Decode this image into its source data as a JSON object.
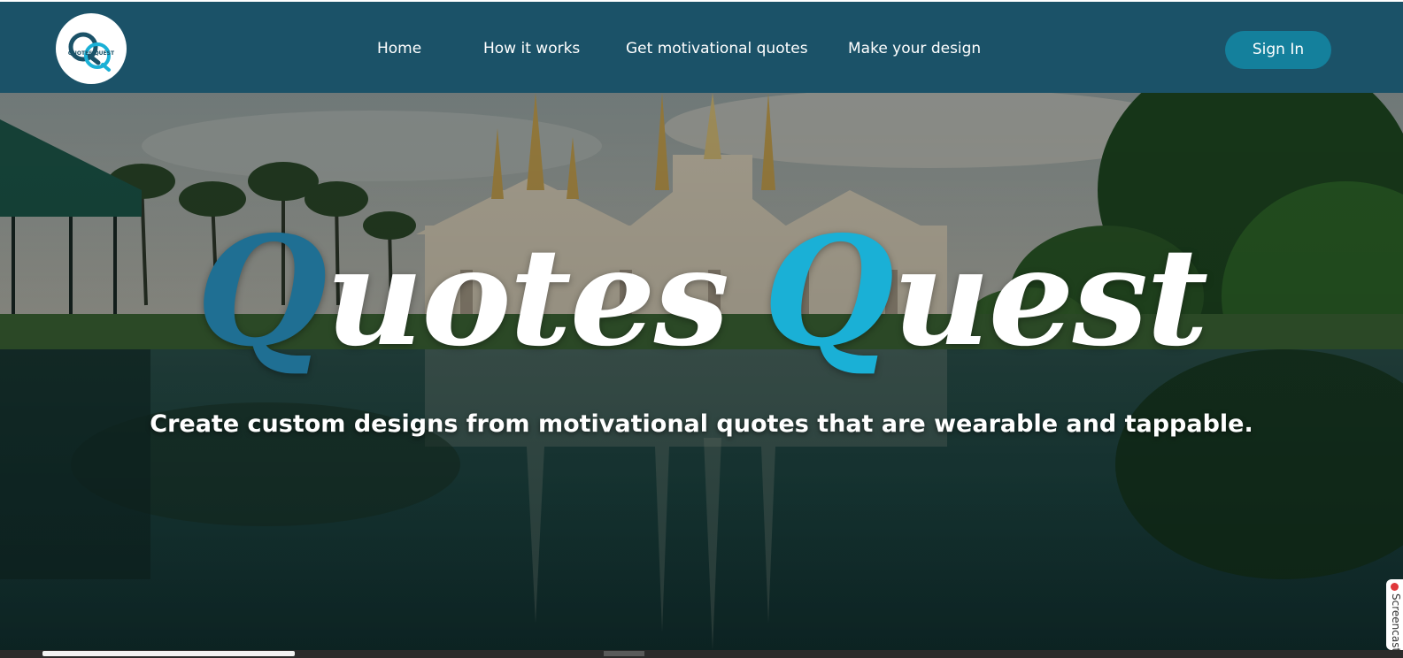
{
  "nav": {
    "logo_alt": "QUOTES QUEST",
    "links": [
      "Home",
      "How it works",
      "Get motivational quotes",
      "Make your design"
    ],
    "sign_in": "Sign In"
  },
  "hero": {
    "title_q1": "Q",
    "title_word1": "uotes",
    "title_q2": "Q",
    "title_word2": "uest",
    "subtitle": "Create custom designs from motivational quotes that are wearable and tappable."
  },
  "recorder": {
    "label": "Screencast"
  },
  "colors": {
    "navbar": "#1b5268",
    "accent": "#14809c",
    "q1": "#1f6f93",
    "q2": "#1ab0d6"
  },
  "icons": {
    "logo": "quotes-quest-logo",
    "record": "record-dot-icon"
  }
}
